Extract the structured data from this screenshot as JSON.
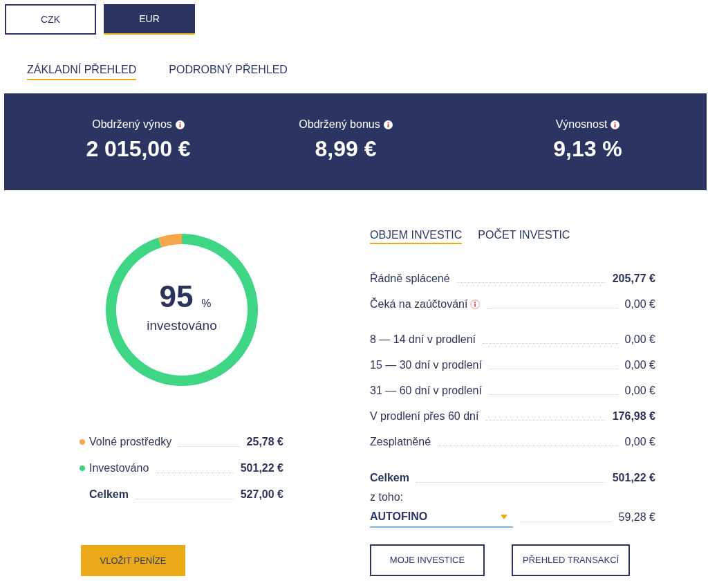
{
  "currency_switch": [
    {
      "label": "CZK",
      "selected": false
    },
    {
      "label": "EUR",
      "selected": true
    }
  ],
  "view_tabs": [
    {
      "label": "ZÁKLADNÍ PŘEHLED",
      "selected": true
    },
    {
      "label": "PODROBNÝ PŘEHLED",
      "selected": false
    }
  ],
  "summary": [
    {
      "label": "Obdržený výnos",
      "info": true,
      "value": "2 015,00 €"
    },
    {
      "label": "Obdržený bonus",
      "info": true,
      "value": "8,99 €"
    },
    {
      "label": "Výnosnost",
      "info": true,
      "value": "9,13 %"
    }
  ],
  "allocation": {
    "percent": "95",
    "unit": "%",
    "caption": "investováno",
    "chart_data": {
      "type": "donut",
      "categories": [
        "Volné prostředky",
        "Investováno"
      ],
      "values": [
        5,
        95
      ]
    },
    "legend": [
      {
        "value": "25,78 €",
        "color": "#f7a54a"
      },
      {
        "value": "501,22 €",
        "color": "#3ed685"
      }
    ],
    "total": {
      "label": "Celkem",
      "value": "527,00 €"
    },
    "deposit_button": "VLOŽIT PENÍZE"
  },
  "investments": {
    "tabs": [
      {
        "label": "OBJEM INVESTIC",
        "selected": true
      },
      {
        "label": "POČET INVESTIC",
        "selected": false
      }
    ],
    "groups": [
      [
        {
          "label": "Řádně splácené",
          "info": false,
          "bold": true,
          "value": "205,77 €"
        },
        {
          "label": "Čeká na zaúčtování",
          "info": true,
          "bold": false,
          "value": "0,00 €"
        }
      ],
      [
        {
          "label": "8 — 14 dní v prodlení",
          "info": false,
          "bold": false,
          "value": "0,00 €"
        },
        {
          "label": "15 — 30 dní v prodlení",
          "info": false,
          "bold": false,
          "value": "0,00 €"
        },
        {
          "label": "31 — 60 dní v prodlení",
          "info": false,
          "bold": false,
          "value": "0,00 €"
        },
        {
          "label": "V prodlení přes 60 dní",
          "info": false,
          "bold": true,
          "value": "176,98 €"
        },
        {
          "label": "Zesplatněné",
          "info": false,
          "bold": false,
          "value": "0,00 €"
        }
      ]
    ],
    "total": {
      "label": "Celkem",
      "value": "501,22 €"
    },
    "breakdown_label": "z toho:",
    "provider": {
      "value": "AUTOFINO",
      "amount": "59,28 €"
    },
    "buttons": [
      "MOJE INVESTICE",
      "PŘEHLED TRANSAKCÍ"
    ]
  }
}
